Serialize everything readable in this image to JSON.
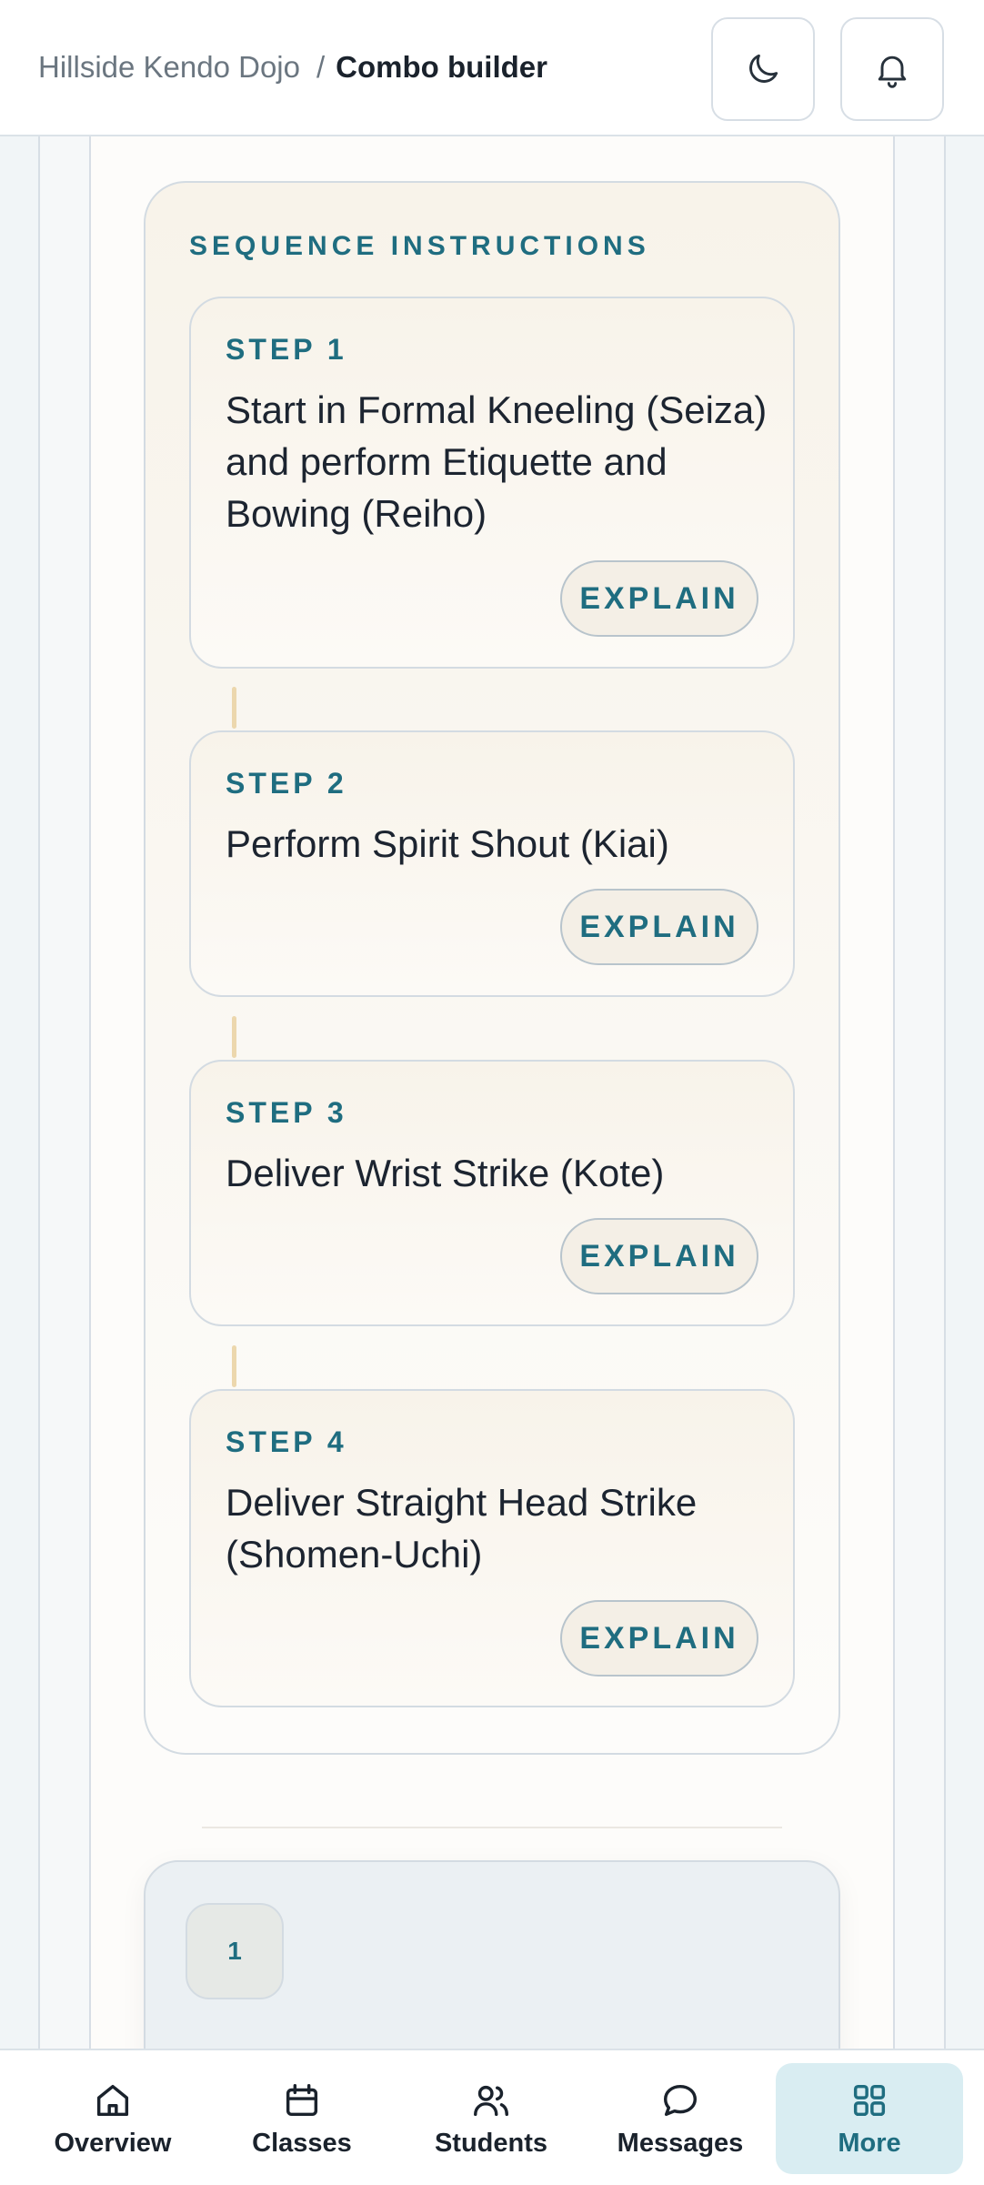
{
  "header": {
    "breadcrumb_root": "Hillside Kendo Dojo",
    "breadcrumb_separator": "/",
    "breadcrumb_current": "Combo builder",
    "buttons": [
      {
        "icon": "moon-icon",
        "purpose": "theme toggle"
      },
      {
        "icon": "bell-icon",
        "purpose": "notifications"
      }
    ]
  },
  "sequence": {
    "title": "SEQUENCE INSTRUCTIONS",
    "steps": [
      {
        "label": "STEP 1",
        "text": "Start in Formal Kneeling (Seiza) and perform Etiquette and Bowing (Reiho)",
        "button": "EXPLAIN"
      },
      {
        "label": "STEP 2",
        "text": "Perform Spirit Shout (Kiai)",
        "button": "EXPLAIN"
      },
      {
        "label": "STEP 3",
        "text": "Deliver Wrist Strike (Kote)",
        "button": "EXPLAIN"
      },
      {
        "label": "STEP 4",
        "text": "Deliver Straight Head Strike (Shomen-Uchi)",
        "button": "EXPLAIN"
      }
    ]
  },
  "next_panel": {
    "chip": "1"
  },
  "bottom_nav": {
    "items": [
      {
        "label": "Overview",
        "icon": "home-icon",
        "active": false
      },
      {
        "label": "Classes",
        "icon": "calendar-icon",
        "active": false
      },
      {
        "label": "Students",
        "icon": "users-icon",
        "active": false
      },
      {
        "label": "Messages",
        "icon": "message-icon",
        "active": false
      },
      {
        "label": "More",
        "icon": "grid-icon",
        "active": true
      }
    ]
  },
  "colors": {
    "accent": "#1f6d80",
    "active_nav_bg": "#d9edf2",
    "connector": "#ecd7ad"
  }
}
